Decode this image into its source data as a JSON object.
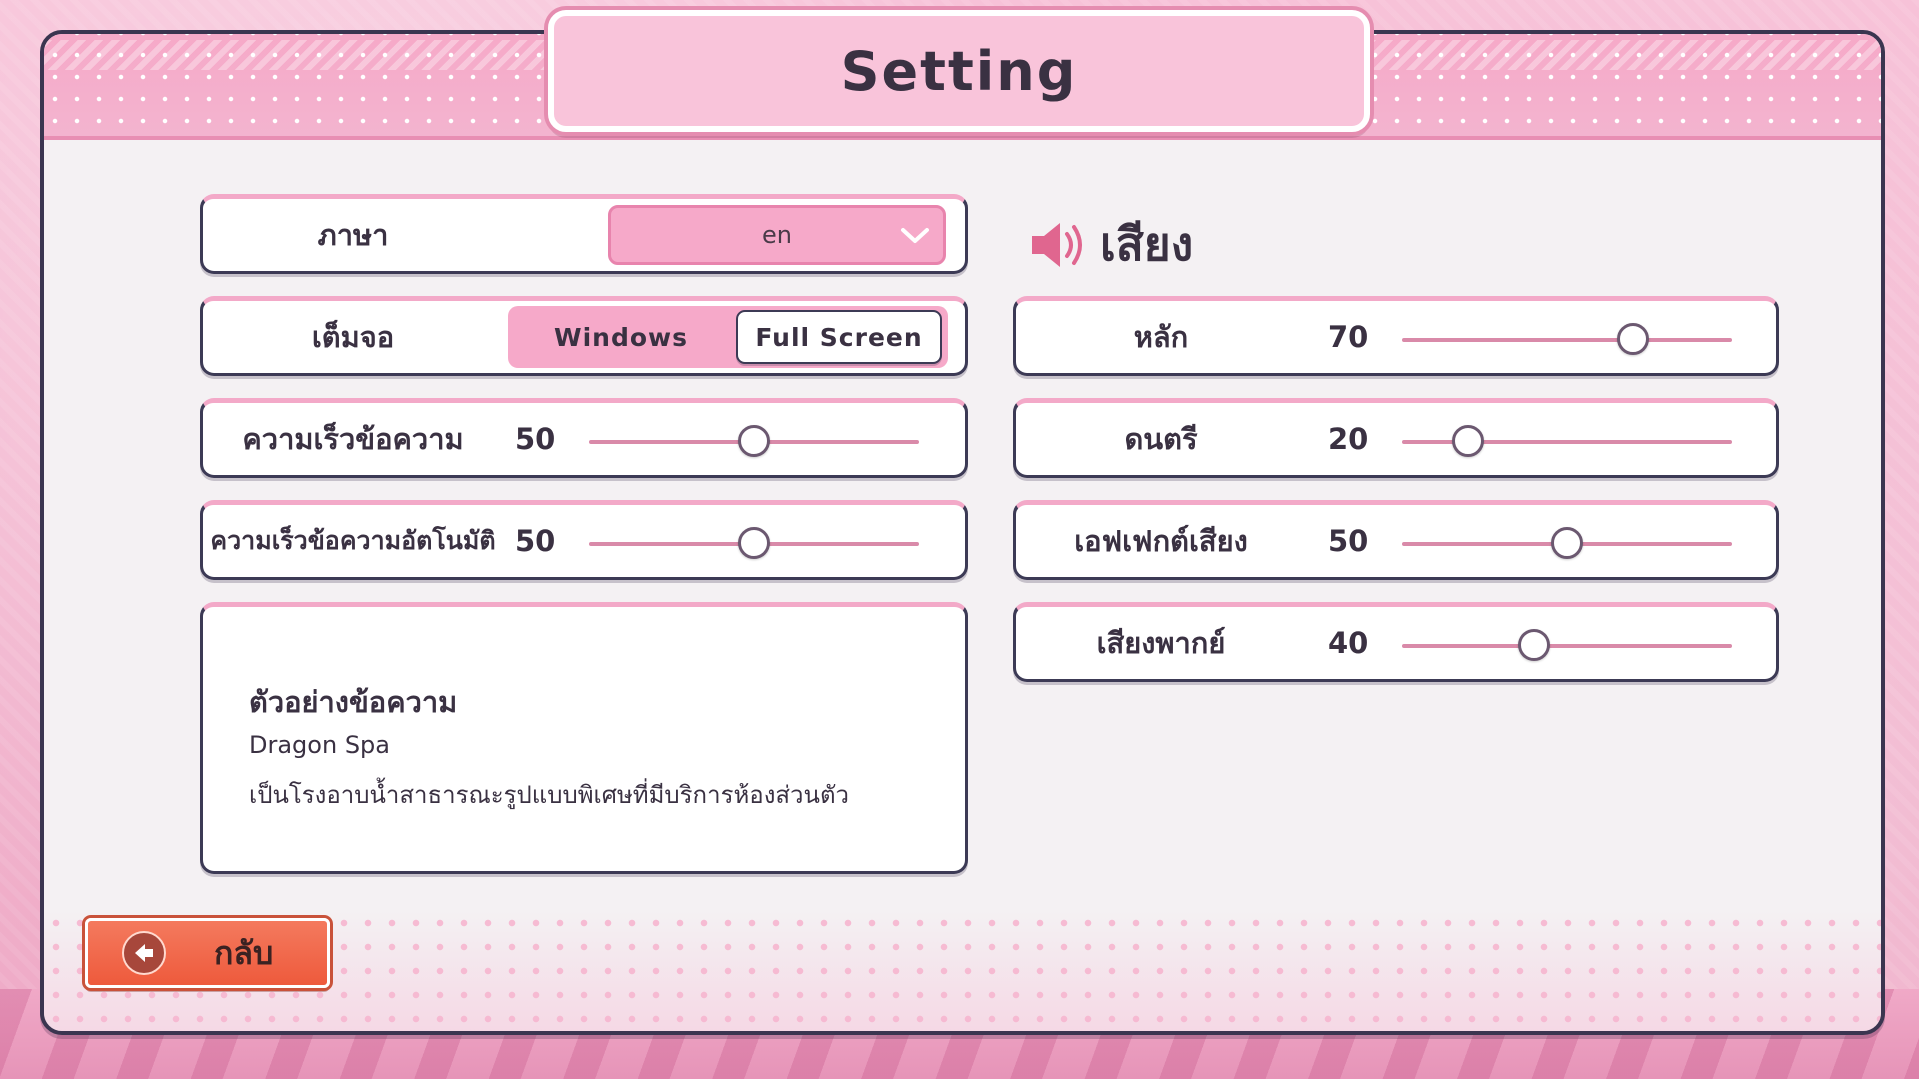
{
  "title": "Setting",
  "left": {
    "language": {
      "label": "ภาษา",
      "value": "en"
    },
    "fullscreen": {
      "label": "เต็มจอ",
      "options": [
        "Windows",
        "Full Screen"
      ],
      "selected": "Full Screen"
    },
    "text_speed": {
      "label": "ความเร็วข้อความ",
      "value": 50,
      "value_text": "50",
      "max": 100
    },
    "auto_speed": {
      "label": "ความเร็วข้อความอัตโนมัติ",
      "value": 50,
      "value_text": "50",
      "max": 100
    },
    "preview": {
      "title": "ตัวอย่างข้อความ",
      "name": "Dragon Spa",
      "body": "เป็นโรงอาบน้ำสาธารณะรูปแบบพิเศษที่มีบริการห้องส่วนตัว"
    }
  },
  "sound": {
    "header": "เสียง",
    "icon": "speaker-icon",
    "items": [
      {
        "label": "หลัก",
        "value": 70,
        "value_text": "70"
      },
      {
        "label": "ดนตรี",
        "value": 20,
        "value_text": "20"
      },
      {
        "label": "เอฟเฟกต์เสียง",
        "value": 50,
        "value_text": "50"
      },
      {
        "label": "เสียงพากย์",
        "value": 40,
        "value_text": "40"
      }
    ]
  },
  "back": {
    "label": "กลับ",
    "icon": "back-arrow-icon"
  },
  "colors": {
    "accent": "#f6a9c9",
    "border": "#3c3a55",
    "back_button": "#ee5a3c",
    "slider_track": "#d98aa9"
  }
}
